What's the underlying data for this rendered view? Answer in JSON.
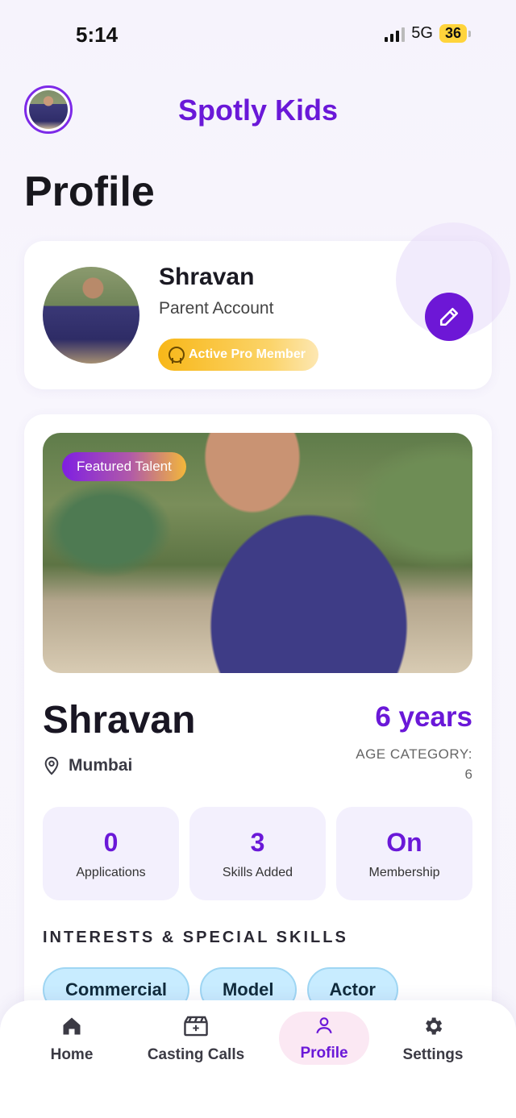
{
  "status_bar": {
    "time": "5:14",
    "network": "5G",
    "battery": "36"
  },
  "header": {
    "app_title": "Spotly Kids"
  },
  "page": {
    "title": "Profile"
  },
  "account": {
    "name": "Shravan",
    "type": "Parent Account",
    "badge": "Active Pro Member"
  },
  "talent": {
    "featured_label": "Featured Talent",
    "name": "Shravan",
    "location": "Mumbai",
    "age": "6 years",
    "age_category_label": "AGE CATEGORY:",
    "age_category_value": "6",
    "stats": [
      {
        "value": "0",
        "label": "Applications"
      },
      {
        "value": "3",
        "label": "Skills Added"
      },
      {
        "value": "On",
        "label": "Membership"
      }
    ],
    "skills_heading": "INTERESTS & SPECIAL SKILLS",
    "skills": [
      "Commercial",
      "Model",
      "Actor"
    ]
  },
  "nav": [
    {
      "label": "Home",
      "icon": "home-icon"
    },
    {
      "label": "Casting Calls",
      "icon": "clapperboard-icon"
    },
    {
      "label": "Profile",
      "icon": "person-icon",
      "active": true
    },
    {
      "label": "Settings",
      "icon": "gear-icon"
    }
  ],
  "colors": {
    "brand": "#6a18d8",
    "badge_gold": "#f8b718",
    "chip_bg": "#c8ecff",
    "nav_active_bg": "#fbe8f3"
  }
}
